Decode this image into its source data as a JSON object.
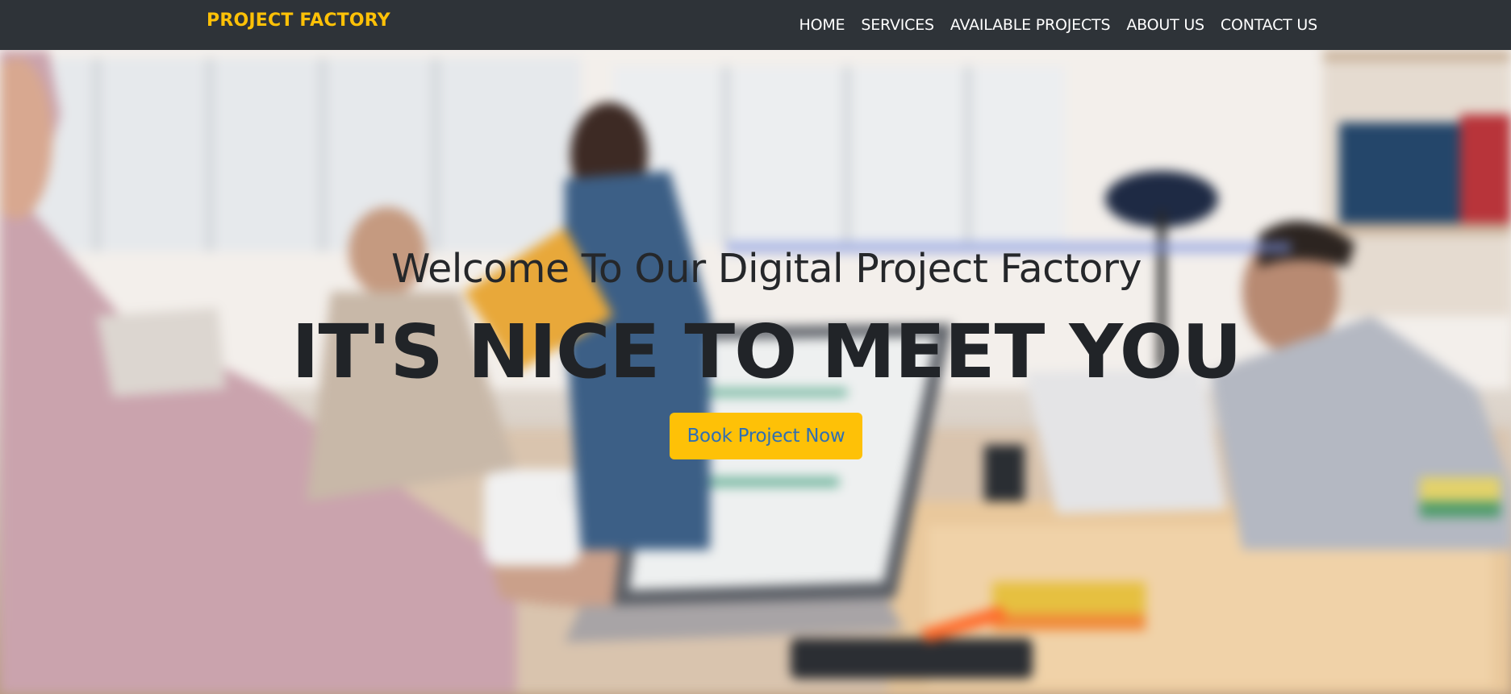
{
  "navbar": {
    "brand": "PROJECT FACTORY",
    "links": [
      {
        "label": "HOME"
      },
      {
        "label": "SERVICES"
      },
      {
        "label": "AVAILABLE PROJECTS"
      },
      {
        "label": "ABOUT US"
      },
      {
        "label": "CONTACT US"
      }
    ]
  },
  "hero": {
    "subheading": "Welcome To Our Digital Project Factory",
    "heading": "IT'S NICE TO MEET YOU",
    "cta_label": "Book Project Now",
    "background": "office-team-photo"
  },
  "colors": {
    "navbar_bg": "#2e3338",
    "brand": "#fec107",
    "cta_bg": "#fec107",
    "cta_text": "#2f6fb3",
    "heading_text": "#212428"
  }
}
